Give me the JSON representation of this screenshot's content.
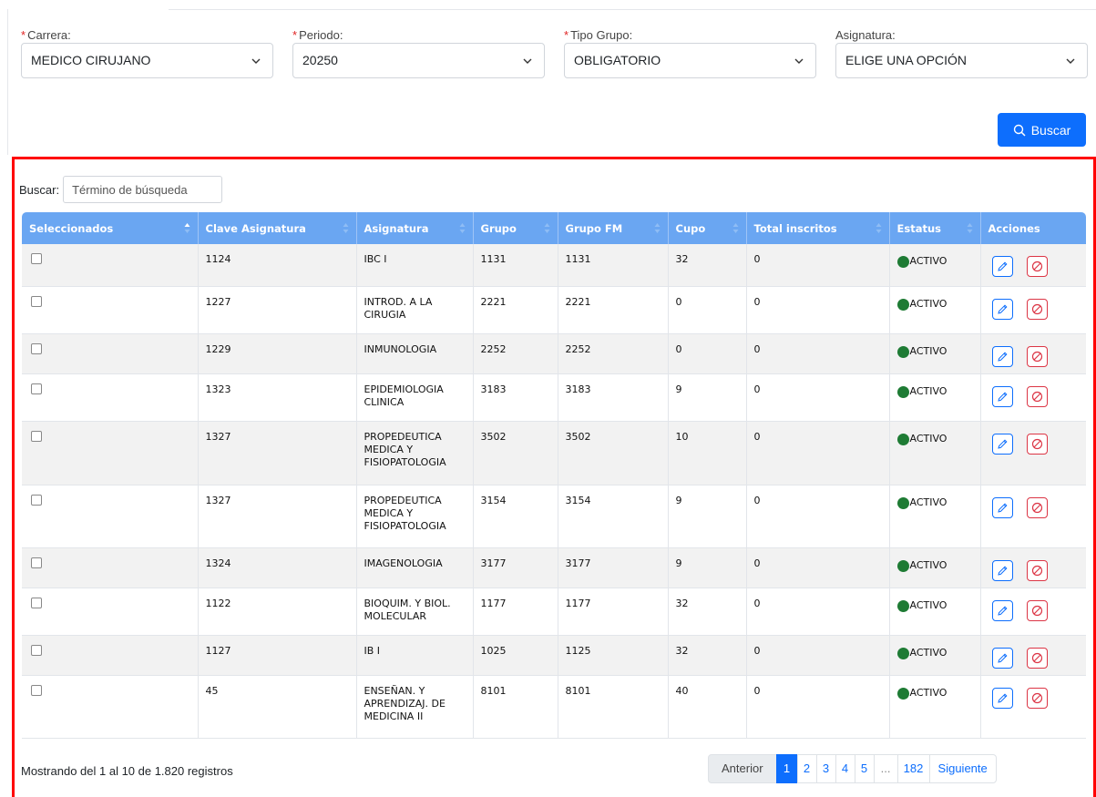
{
  "filters": [
    {
      "label": "Carrera:",
      "required": true,
      "value": "MEDICO CIRUJANO"
    },
    {
      "label": "Periodo:",
      "required": true,
      "value": "20250"
    },
    {
      "label": "Tipo Grupo:",
      "required": true,
      "value": "OBLIGATORIO"
    },
    {
      "label": "Asignatura:",
      "required": false,
      "value": "ELIGE UNA OPCIÓN"
    }
  ],
  "required_mark": "*",
  "buscar_button": "Buscar",
  "search": {
    "label": "Buscar:",
    "placeholder": "Término de búsqueda"
  },
  "columns": [
    "Seleccionados",
    "Clave Asignatura",
    "Asignatura",
    "Grupo",
    "Grupo FM",
    "Cupo",
    "Total inscritos",
    "Estatus",
    "Acciones"
  ],
  "rows": [
    {
      "clave": "1124",
      "asignatura": [
        "IBC I"
      ],
      "grupo": "1131",
      "grupo_fm": "1131",
      "cupo": "32",
      "inscritos": "0",
      "estatus": "ACTIVO"
    },
    {
      "clave": "1227",
      "asignatura": [
        "INTROD. A LA",
        "CIRUGIA"
      ],
      "grupo": "2221",
      "grupo_fm": "2221",
      "cupo": "0",
      "inscritos": "0",
      "estatus": "ACTIVO"
    },
    {
      "clave": "1229",
      "asignatura": [
        "INMUNOLOGIA"
      ],
      "grupo": "2252",
      "grupo_fm": "2252",
      "cupo": "0",
      "inscritos": "0",
      "estatus": "ACTIVO"
    },
    {
      "clave": "1323",
      "asignatura": [
        "EPIDEMIOLOGIA",
        "CLINICA"
      ],
      "grupo": "3183",
      "grupo_fm": "3183",
      "cupo": "9",
      "inscritos": "0",
      "estatus": "ACTIVO"
    },
    {
      "clave": "1327",
      "asignatura": [
        "PROPEDEUTICA",
        "MEDICA Y",
        "FISIOPATOLOGIA"
      ],
      "grupo": "3502",
      "grupo_fm": "3502",
      "cupo": "10",
      "inscritos": "0",
      "estatus": "ACTIVO"
    },
    {
      "clave": "1327",
      "asignatura": [
        "PROPEDEUTICA",
        "MEDICA Y",
        "FISIOPATOLOGIA"
      ],
      "grupo": "3154",
      "grupo_fm": "3154",
      "cupo": "9",
      "inscritos": "0",
      "estatus": "ACTIVO"
    },
    {
      "clave": "1324",
      "asignatura": [
        "IMAGENOLOGIA"
      ],
      "grupo": "3177",
      "grupo_fm": "3177",
      "cupo": "9",
      "inscritos": "0",
      "estatus": "ACTIVO"
    },
    {
      "clave": "1122",
      "asignatura": [
        "BIOQUIM. Y BIOL.",
        "MOLECULAR"
      ],
      "grupo": "1177",
      "grupo_fm": "1177",
      "cupo": "32",
      "inscritos": "0",
      "estatus": "ACTIVO"
    },
    {
      "clave": "1127",
      "asignatura": [
        "IB I"
      ],
      "grupo": "1025",
      "grupo_fm": "1125",
      "cupo": "32",
      "inscritos": "0",
      "estatus": "ACTIVO"
    },
    {
      "clave": "45",
      "asignatura": [
        "ENSEÑAN. Y",
        "APRENDIZAJ. DE",
        "MEDICINA II"
      ],
      "grupo": "8101",
      "grupo_fm": "8101",
      "cupo": "40",
      "inscritos": "0",
      "estatus": "ACTIVO"
    }
  ],
  "info_text": "Mostrando del 1 al 10 de 1.820 registros",
  "pagination": {
    "prev": "Anterior",
    "pages": [
      "1",
      "2",
      "3",
      "4",
      "5"
    ],
    "ellipsis": "...",
    "last": "182",
    "next": "Siguiente",
    "active": "1"
  },
  "colors": {
    "primary": "#0d6efd",
    "header": "#6aa6f2",
    "highlight": "#ff0000",
    "status_active": "#1e7b34",
    "danger": "#dc3545"
  },
  "icons": {
    "select": "chevron-down-icon",
    "buscar": "search-icon",
    "edit": "pencil-icon",
    "delete": "ban-icon",
    "sort": "sort-icon"
  }
}
